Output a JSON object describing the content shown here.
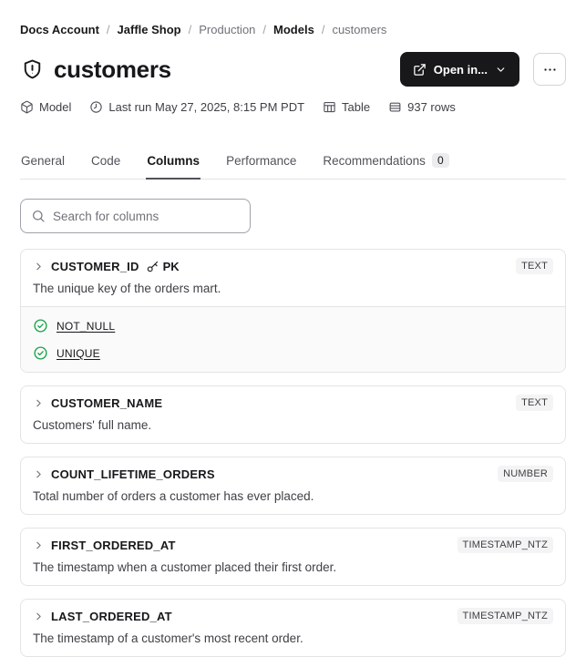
{
  "breadcrumb": {
    "separator": "/",
    "items": [
      {
        "label": "Docs Account",
        "emphasis": true
      },
      {
        "label": "Jaffle Shop",
        "emphasis": true
      },
      {
        "label": "Production",
        "emphasis": false
      },
      {
        "label": "Models",
        "emphasis": true
      },
      {
        "label": "customers",
        "emphasis": false
      }
    ]
  },
  "header": {
    "title": "customers",
    "open_in_label": "Open in...",
    "meta": [
      {
        "icon": "cube-icon",
        "label": "Model"
      },
      {
        "icon": "clock-icon",
        "label": "Last run May 27, 2025, 8:15 PM PDT"
      },
      {
        "icon": "table-icon",
        "label": "Table"
      },
      {
        "icon": "rows-icon",
        "label": "937 rows"
      }
    ]
  },
  "tabs": [
    {
      "label": "General",
      "active": false
    },
    {
      "label": "Code",
      "active": false
    },
    {
      "label": "Columns",
      "active": true
    },
    {
      "label": "Performance",
      "active": false
    },
    {
      "label": "Recommendations",
      "active": false,
      "badge": "0"
    }
  ],
  "search": {
    "placeholder": "Search for columns"
  },
  "columns": [
    {
      "name": "CUSTOMER_ID",
      "pk_label": "PK",
      "type": "TEXT",
      "description": "The unique key of the orders mart.",
      "tests": [
        "NOT_NULL",
        "UNIQUE"
      ]
    },
    {
      "name": "CUSTOMER_NAME",
      "type": "TEXT",
      "description": "Customers' full name."
    },
    {
      "name": "COUNT_LIFETIME_ORDERS",
      "type": "NUMBER",
      "description": "Total number of orders a customer has ever placed."
    },
    {
      "name": "FIRST_ORDERED_AT",
      "type": "TIMESTAMP_NTZ",
      "description": "The timestamp when a customer placed their first order."
    },
    {
      "name": "LAST_ORDERED_AT",
      "type": "TIMESTAMP_NTZ",
      "description": "The timestamp of a customer's most recent order."
    }
  ],
  "colors": {
    "primary_button_bg": "#18181b",
    "test_pass_green": "#16a34a",
    "active_tab_underline": "#52525b",
    "card_border": "#e4e4e7",
    "type_badge_bg": "#f4f4f5"
  }
}
